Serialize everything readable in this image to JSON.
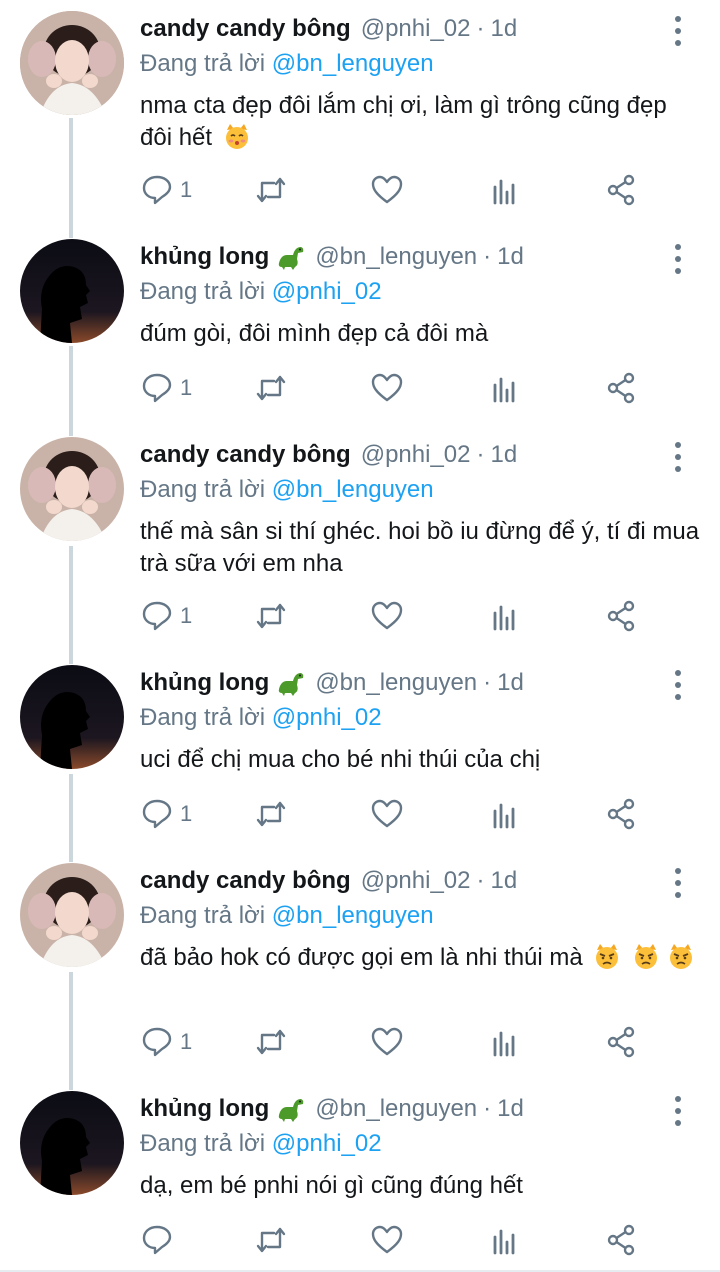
{
  "colors": {
    "text": "#14171a",
    "secondary": "#657786",
    "link": "#1da1f2",
    "thread_line": "#ccd6dd"
  },
  "icons": {
    "reply": "reply-icon",
    "retweet": "retweet-icon",
    "like": "heart-icon",
    "stats": "stats-icon",
    "share": "share-icon",
    "more": "more-vertical-icon",
    "dino": "dinosaur-emoji",
    "kiss_cat": "kissing-cat-emoji",
    "pouting_cat": "pouting-cat-emoji"
  },
  "tweets": [
    {
      "name": "candy candy bông",
      "handle": "@pnhi_02",
      "sep": "·",
      "time": "1d",
      "reply_prefix": "Đang trả lời",
      "reply_to": "@bn_lenguyen",
      "text": "nma cta đẹp đôi lắm chị ơi, làm gì trông cũng đẹp đôi hết",
      "reply_count": "1"
    },
    {
      "name": "khủng long",
      "handle": "@bn_lenguyen",
      "sep": "·",
      "time": "1d",
      "reply_prefix": "Đang trả lời",
      "reply_to": "@pnhi_02",
      "text": "đúm gòi, đôi mình đẹp cả đôi mà",
      "reply_count": "1"
    },
    {
      "name": "candy candy bông",
      "handle": "@pnhi_02",
      "sep": "·",
      "time": "1d",
      "reply_prefix": "Đang trả lời",
      "reply_to": "@bn_lenguyen",
      "text": "thế mà sân si thí ghéc. hoi bồ iu đừng để ý, tí đi mua trà sữa với em nha",
      "reply_count": "1"
    },
    {
      "name": "khủng long",
      "handle": "@bn_lenguyen",
      "sep": "·",
      "time": "1d",
      "reply_prefix": "Đang trả lời",
      "reply_to": "@pnhi_02",
      "text": "uci để chị mua cho bé nhi thúi của chị",
      "reply_count": "1"
    },
    {
      "name": "candy candy bông",
      "handle": "@pnhi_02",
      "sep": "·",
      "time": "1d",
      "reply_prefix": "Đang trả lời",
      "reply_to": "@bn_lenguyen",
      "text": "đã bảo hok có được gọi em là nhi thúi mà",
      "reply_count": "1"
    },
    {
      "name": "khủng long",
      "handle": "@bn_lenguyen",
      "sep": "·",
      "time": "1d",
      "reply_prefix": "Đang trả lời",
      "reply_to": "@pnhi_02",
      "text": "dạ, em bé pnhi nói gì cũng đúng hết",
      "reply_count": ""
    }
  ]
}
